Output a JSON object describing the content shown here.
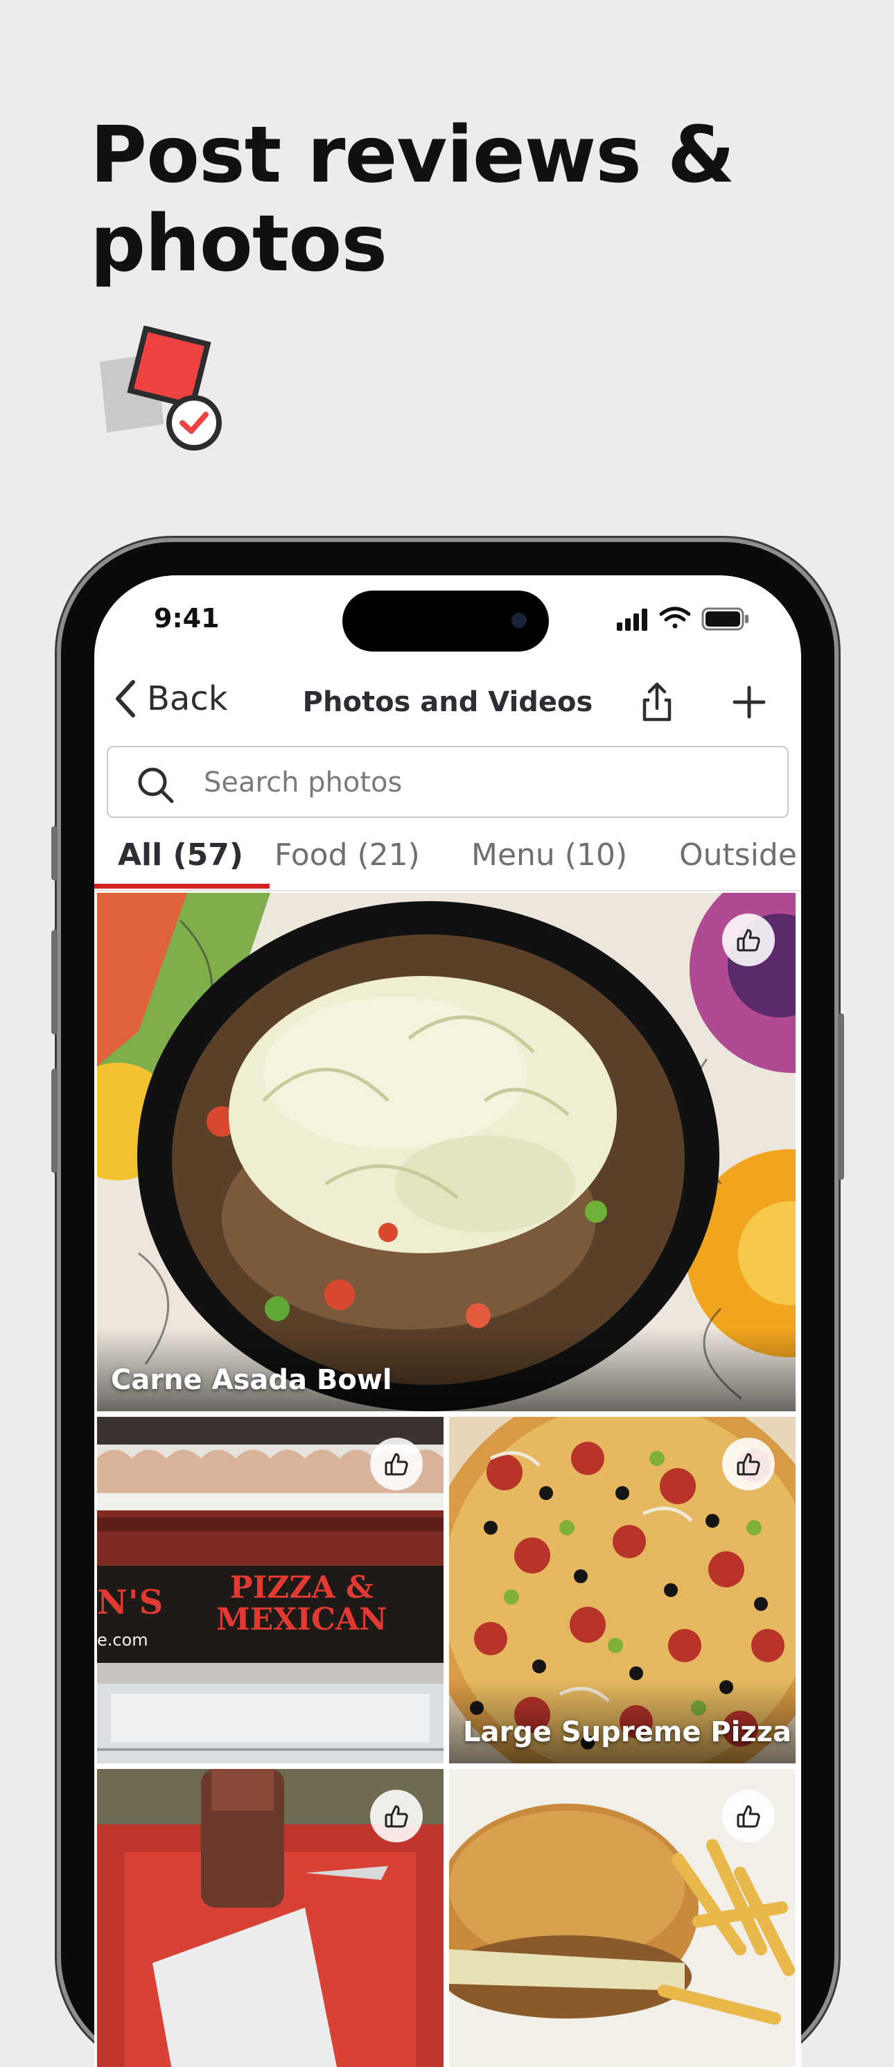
{
  "promo": {
    "headline_line1": "Post reviews &",
    "headline_line2": "photos"
  },
  "status_bar": {
    "time": "9:41"
  },
  "nav": {
    "back_label": "Back",
    "title": "Photos and Videos"
  },
  "search": {
    "placeholder": "Search photos"
  },
  "tabs": [
    {
      "label": "All (57)"
    },
    {
      "label": "Food (21)"
    },
    {
      "label": "Menu (10)"
    },
    {
      "label": "Outside"
    }
  ],
  "photos": [
    {
      "caption": "Carne Asada Bowl"
    },
    {
      "caption": ""
    },
    {
      "caption": "Large Supreme Pizza"
    },
    {
      "caption": ""
    },
    {
      "caption": ""
    }
  ],
  "storefront_sign": {
    "line1": "PIZZA &",
    "line2": "MEXICAN",
    "left": "N'S",
    "web": "e.com"
  },
  "colors": {
    "accent": "#d32323",
    "background": "#ececec",
    "text_primary": "#2d2e33"
  },
  "icons": [
    "promo-photo-check-icon",
    "chevron-left-icon",
    "share-icon",
    "plus-icon",
    "search-icon",
    "thumbs-up-icon",
    "signal-icon",
    "wifi-icon",
    "battery-icon"
  ]
}
